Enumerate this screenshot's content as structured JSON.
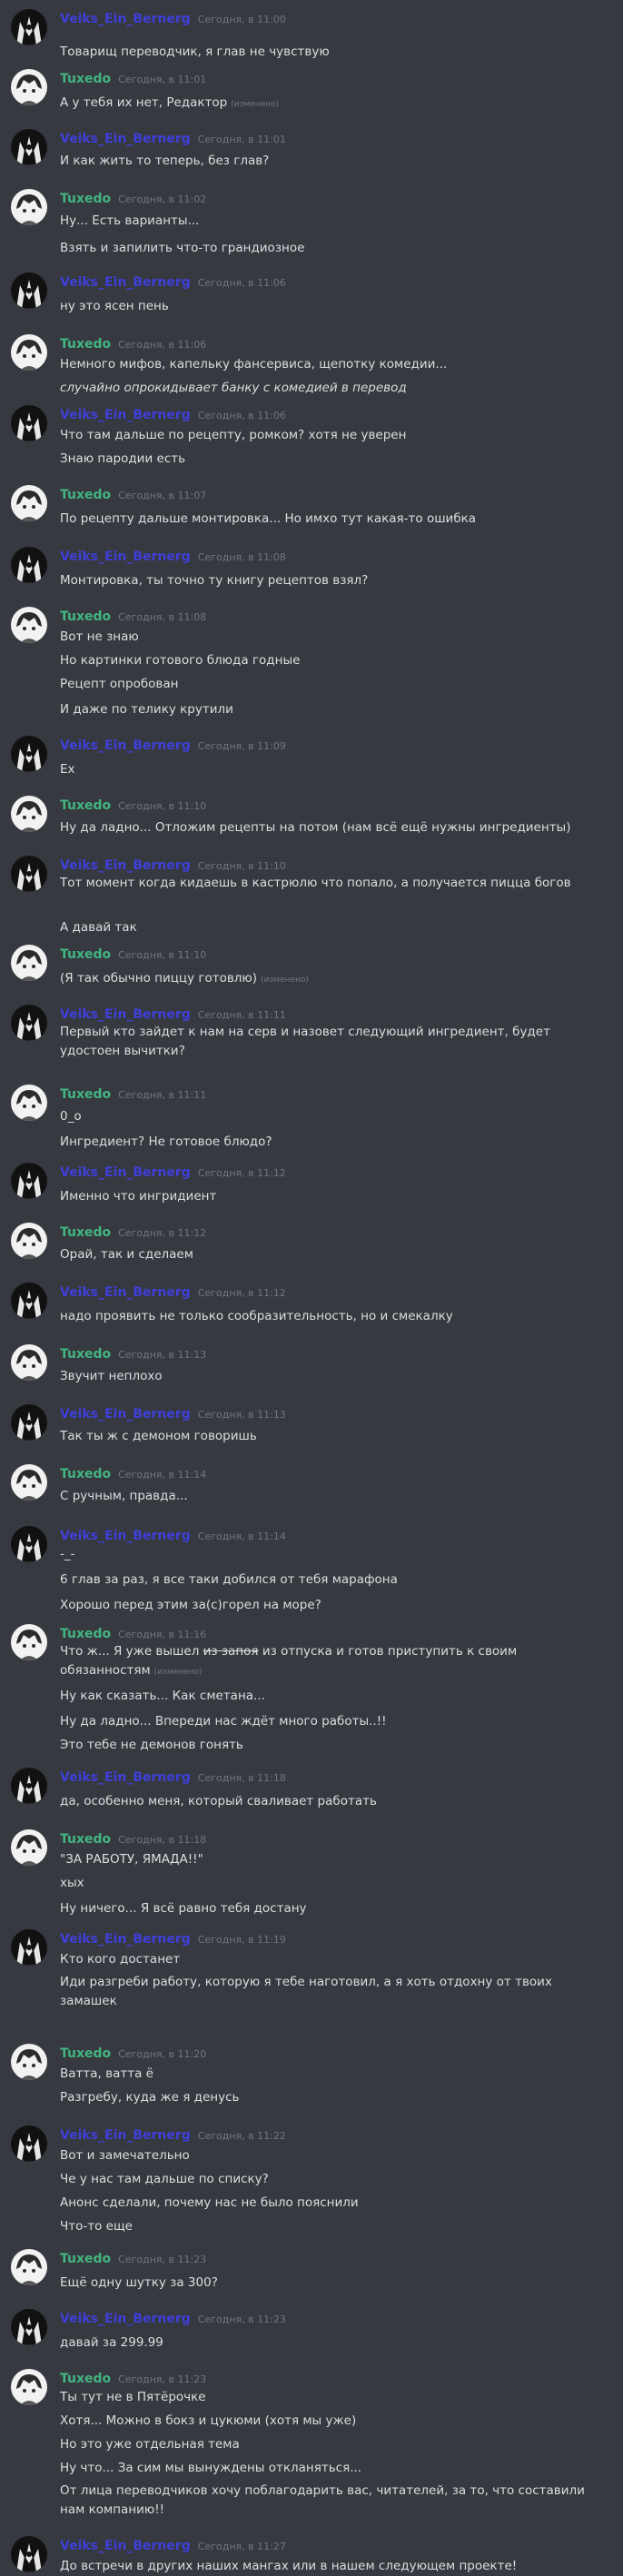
{
  "users": {
    "a": "Veiks_Ein_Bernerg",
    "b": "Tuxedo"
  },
  "edited_label": "(изменено)",
  "messages": [
    {
      "author": "a",
      "time": "Сегодня, в 11:00",
      "lines": [
        "Товарищ переводчик, я глав не чувствую"
      ]
    },
    {
      "author": "b",
      "time": "Сегодня, в 11:01",
      "lines": [
        "А у тебя их нет, Редактор"
      ],
      "edited": [
        0
      ]
    },
    {
      "author": "a",
      "time": "Сегодня, в 11:01",
      "lines": [
        "И как жить то теперь, без глав?"
      ]
    },
    {
      "author": "b",
      "time": "Сегодня, в 11:02",
      "lines": [
        "Ну... Есть варианты...",
        "Взять и запилить что-то грандиозное"
      ]
    },
    {
      "author": "a",
      "time": "Сегодня, в 11:06",
      "lines": [
        "ну это ясен пень"
      ]
    },
    {
      "author": "b",
      "time": "Сегодня, в 11:06",
      "lines": [
        "Немного мифов, капельку фансервиса, щепотку комедии...",
        "случайно опрокидывает банку с комедией в перевод"
      ],
      "italic": [
        1
      ]
    },
    {
      "author": "a",
      "time": "Сегодня, в 11:06",
      "lines": [
        "Что там дальше по рецепту, ромком? хотя не уверен",
        "Знаю пародии есть"
      ]
    },
    {
      "author": "b",
      "time": "Сегодня, в 11:07",
      "lines": [
        "По рецепту дальше монтировка... Но имхо тут какая-то ошибка"
      ]
    },
    {
      "author": "a",
      "time": "Сегодня, в 11:08",
      "lines": [
        "Монтировка, ты точно ту книгу рецептов взял?"
      ]
    },
    {
      "author": "b",
      "time": "Сегодня, в 11:08",
      "lines": [
        "Вот не знаю",
        "Но картинки готового блюда годные",
        "Рецепт опробован",
        "И даже по телику крутили"
      ]
    },
    {
      "author": "a",
      "time": "Сегодня, в 11:09",
      "lines": [
        "Ex"
      ]
    },
    {
      "author": "b",
      "time": "Сегодня, в 11:10",
      "lines": [
        "Ну да ладно... Отложим рецепты на потом (нам всё ещё нужны ингредиенты)"
      ]
    },
    {
      "author": "a",
      "time": "Сегодня, в 11:10",
      "lines": [
        "Тот момент когда кидаешь в кастрюлю что попало, а получается пицца богов",
        "А давай так"
      ],
      "wrap": [
        0
      ]
    },
    {
      "author": "b",
      "time": "Сегодня, в 11:10",
      "lines": [
        "(Я так обычно пиццу готовлю)"
      ],
      "edited": [
        0
      ]
    },
    {
      "author": "a",
      "time": "Сегодня, в 11:11",
      "lines": [
        "Первый кто зайдет к нам на серв и назовет следующий ингредиент, будет удостоен вычитки?"
      ],
      "wrap": [
        0
      ]
    },
    {
      "author": "b",
      "time": "Сегодня, в 11:11",
      "lines": [
        "0_о",
        "Ингредиент? Не готовое блюдо?"
      ]
    },
    {
      "author": "a",
      "time": "Сегодня, в 11:12",
      "lines": [
        "Именно что ингридиент"
      ]
    },
    {
      "author": "b",
      "time": "Сегодня, в 11:12",
      "lines": [
        "Орай, так и сделаем"
      ]
    },
    {
      "author": "a",
      "time": "Сегодня, в 11:12",
      "lines": [
        "надо проявить не только сообразительность, но и смекалку"
      ]
    },
    {
      "author": "b",
      "time": "Сегодня, в 11:13",
      "lines": [
        "Звучит неплохо"
      ]
    },
    {
      "author": "a",
      "time": "Сегодня, в 11:13",
      "lines": [
        "Так ты ж с демоном говоришь"
      ]
    },
    {
      "author": "b",
      "time": "Сегодня, в 11:14",
      "lines": [
        "С ручным, правда..."
      ]
    },
    {
      "author": "a",
      "time": "Сегодня, в 11:14",
      "lines": [
        "-_-",
        "6 глав за раз, я все таки добился от тебя марафона",
        "Хорошо перед этим за(с)горел на море?"
      ]
    },
    {
      "author": "b",
      "time": "Сегодня, в 11:16",
      "lines": [
        "Что ж... Я уже вышел из запоя из отпуска и готов приступить к своим обязанностям",
        "Ну как сказать... Как сметана...",
        "Ну да ладно... Впереди нас ждёт много работы..!!",
        "Это тебе не демонов гонять"
      ],
      "wrap": [
        0
      ],
      "edited": [
        0
      ]
    },
    {
      "author": "a",
      "time": "Сегодня, в 11:18",
      "lines": [
        "да, особенно меня, который сваливает работать"
      ]
    },
    {
      "author": "b",
      "time": "Сегодня, в 11:18",
      "lines": [
        "\"ЗА РАБОТУ, ЯМАДА!!\"",
        "хых",
        "Ну ничего... Я всё равно тебя достану"
      ]
    },
    {
      "author": "a",
      "time": "Сегодня, в 11:19",
      "lines": [
        "Кто кого достанет",
        "Иди разгреби работу, которую я тебе наготовил, а я хоть отдохну от твоих замашек"
      ],
      "wrap": [
        1
      ]
    },
    {
      "author": "b",
      "time": "Сегодня, в 11:20",
      "lines": [
        "Ватта, ватта ё",
        "Разгребу, куда же я денусь"
      ]
    },
    {
      "author": "a",
      "time": "Сегодня, в 11:22",
      "lines": [
        "Вот и замечательно",
        "Че у нас там дальше по списку?",
        "Анонс сделали, почему нас не было пояснили",
        "Что-то еще"
      ]
    },
    {
      "author": "b",
      "time": "Сегодня, в 11:23",
      "lines": [
        "Ещё одну шутку за 300?"
      ]
    },
    {
      "author": "a",
      "time": "Сегодня, в 11:23",
      "lines": [
        "давай за 299.99"
      ]
    },
    {
      "author": "b",
      "time": "Сегодня, в 11:23",
      "lines": [
        "Ты тут не в Пятёрочке",
        "Хотя... Можно в бокз и цукюми (хотя мы уже)",
        "Но это уже отдельная тема",
        "Ну что... За сим мы вынуждены откланяться...",
        "От лица переводчиков хочу поблагодарить вас, читателей, за то, что составили нам компанию!!"
      ],
      "wrap": [
        4
      ]
    },
    {
      "author": "a",
      "time": "Сегодня, в 11:27",
      "lines": [
        "До встречи в других наших мангах или в нашем следующем проекте!"
      ]
    }
  ]
}
